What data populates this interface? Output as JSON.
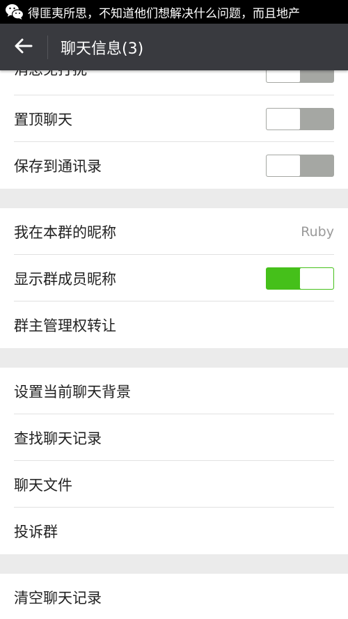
{
  "statusbar": {
    "app_icon": "wechat-icon",
    "notification_text": "得匪夷所思，不知道他们想解决什么问题，而且地产"
  },
  "actionbar": {
    "back_icon": "back-arrow-icon",
    "title": "聊天信息(3)"
  },
  "settings": {
    "group1": {
      "do_not_disturb": {
        "label": "消息免打扰",
        "toggle": "off"
      },
      "sticky_on_top": {
        "label": "置顶聊天",
        "toggle": "off"
      },
      "save_to_contacts": {
        "label": "保存到通讯录",
        "toggle": "off"
      }
    },
    "group2": {
      "my_alias": {
        "label": "我在本群的昵称",
        "value": "Ruby"
      },
      "show_member_alias": {
        "label": "显示群成员昵称",
        "toggle": "on"
      },
      "transfer_owner": {
        "label": "群主管理权转让"
      }
    },
    "group3": {
      "set_background": {
        "label": "设置当前聊天背景"
      },
      "find_history": {
        "label": "查找聊天记录"
      },
      "chat_files": {
        "label": "聊天文件"
      },
      "report_group": {
        "label": "投诉群"
      }
    },
    "group4": {
      "clear_history": {
        "label": "清空聊天记录"
      }
    }
  },
  "colors": {
    "toggle_on": "#45c01a",
    "toggle_off": "#a5a7a3",
    "actionbar": "#393a3f"
  }
}
